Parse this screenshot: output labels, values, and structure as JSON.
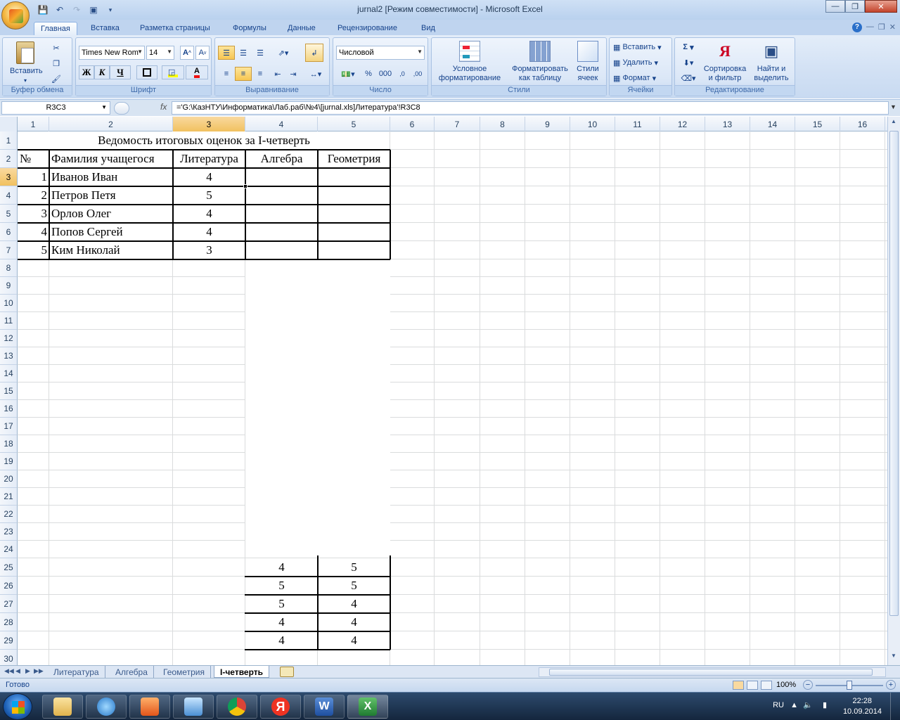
{
  "window": {
    "title": "jurnal2  [Режим совместимости] - Microsoft Excel"
  },
  "ribbon_tabs": [
    "Главная",
    "Вставка",
    "Разметка страницы",
    "Формулы",
    "Данные",
    "Рецензирование",
    "Вид"
  ],
  "clipboard": {
    "paste": "Вставить",
    "group": "Буфер обмена"
  },
  "font": {
    "name": "Times New Rom",
    "size": "14",
    "bold": "Ж",
    "italic": "К",
    "underline": "Ч",
    "group": "Шрифт"
  },
  "alignment": {
    "group": "Выравнивание"
  },
  "number": {
    "format": "Числовой",
    "percent": "%",
    "thousands": "000",
    "group": "Число"
  },
  "styles": {
    "conditional_line1": "Условное",
    "conditional_line2": "форматирование",
    "table_line1": "Форматировать",
    "table_line2": "как таблицу",
    "cell_line1": "Стили",
    "cell_line2": "ячеек",
    "group": "Стили"
  },
  "cells": {
    "insert": "Вставить",
    "delete": "Удалить",
    "format": "Формат",
    "group": "Ячейки"
  },
  "editing": {
    "sum": "Σ",
    "sort_line1": "Сортировка",
    "sort_line2": "и фильтр",
    "find_line1": "Найти и",
    "find_line2": "выделить",
    "group": "Редактирование"
  },
  "formula_bar": {
    "name_box": "R3C3",
    "fx": "fx",
    "formula": "='G:\\КазНТУ\\Информатика\\Лаб.раб\\№4\\[jurnal.xls]Литература'!R3C8"
  },
  "columns": [
    "1",
    "2",
    "3",
    "4",
    "5",
    "6",
    "7",
    "8",
    "9",
    "10",
    "11",
    "12",
    "13",
    "14",
    "15",
    "16"
  ],
  "rows": [
    "1",
    "2",
    "3",
    "4",
    "5",
    "6",
    "7",
    "8",
    "9",
    "10",
    "11",
    "12",
    "13",
    "14",
    "15",
    "16",
    "17",
    "18",
    "19",
    "20",
    "21",
    "22",
    "23",
    "24",
    "25",
    "26",
    "27",
    "28",
    "29",
    "30"
  ],
  "sheet": {
    "title": "Ведомость итоговых оценок за I-четверть",
    "headers": [
      "№",
      "Фамилия учащегося",
      "Литература",
      "Алгебра",
      "Геометрия"
    ],
    "students": [
      {
        "n": "1",
        "name": "Иванов Иван",
        "lit": "4"
      },
      {
        "n": "2",
        "name": "Петров Петя",
        "lit": "5"
      },
      {
        "n": "3",
        "name": "Орлов Олег",
        "lit": "4"
      },
      {
        "n": "4",
        "name": "Попов Сергей",
        "lit": "4"
      },
      {
        "n": "5",
        "name": "Ким Николай",
        "lit": "3"
      }
    ],
    "lower_block": [
      [
        "4",
        "5"
      ],
      [
        "5",
        "5"
      ],
      [
        "5",
        "4"
      ],
      [
        "4",
        "4"
      ],
      [
        "4",
        "4"
      ]
    ]
  },
  "sheet_tabs": [
    "Литература",
    "Алгебра",
    "Геометрия",
    "I-четверть"
  ],
  "status": {
    "ready": "Готово",
    "zoom": "100%"
  },
  "tray": {
    "lang": "RU",
    "time": "22:28",
    "date": "10.09.2014"
  }
}
